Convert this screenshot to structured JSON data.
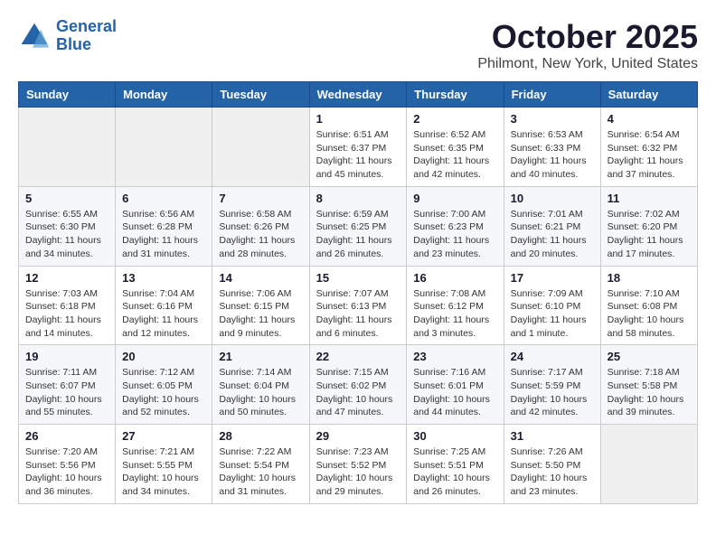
{
  "logo": {
    "line1": "General",
    "line2": "Blue"
  },
  "title": "October 2025",
  "location": "Philmont, New York, United States",
  "weekdays": [
    "Sunday",
    "Monday",
    "Tuesday",
    "Wednesday",
    "Thursday",
    "Friday",
    "Saturday"
  ],
  "weeks": [
    [
      {
        "day": "",
        "info": ""
      },
      {
        "day": "",
        "info": ""
      },
      {
        "day": "",
        "info": ""
      },
      {
        "day": "1",
        "info": "Sunrise: 6:51 AM\nSunset: 6:37 PM\nDaylight: 11 hours and 45 minutes."
      },
      {
        "day": "2",
        "info": "Sunrise: 6:52 AM\nSunset: 6:35 PM\nDaylight: 11 hours and 42 minutes."
      },
      {
        "day": "3",
        "info": "Sunrise: 6:53 AM\nSunset: 6:33 PM\nDaylight: 11 hours and 40 minutes."
      },
      {
        "day": "4",
        "info": "Sunrise: 6:54 AM\nSunset: 6:32 PM\nDaylight: 11 hours and 37 minutes."
      }
    ],
    [
      {
        "day": "5",
        "info": "Sunrise: 6:55 AM\nSunset: 6:30 PM\nDaylight: 11 hours and 34 minutes."
      },
      {
        "day": "6",
        "info": "Sunrise: 6:56 AM\nSunset: 6:28 PM\nDaylight: 11 hours and 31 minutes."
      },
      {
        "day": "7",
        "info": "Sunrise: 6:58 AM\nSunset: 6:26 PM\nDaylight: 11 hours and 28 minutes."
      },
      {
        "day": "8",
        "info": "Sunrise: 6:59 AM\nSunset: 6:25 PM\nDaylight: 11 hours and 26 minutes."
      },
      {
        "day": "9",
        "info": "Sunrise: 7:00 AM\nSunset: 6:23 PM\nDaylight: 11 hours and 23 minutes."
      },
      {
        "day": "10",
        "info": "Sunrise: 7:01 AM\nSunset: 6:21 PM\nDaylight: 11 hours and 20 minutes."
      },
      {
        "day": "11",
        "info": "Sunrise: 7:02 AM\nSunset: 6:20 PM\nDaylight: 11 hours and 17 minutes."
      }
    ],
    [
      {
        "day": "12",
        "info": "Sunrise: 7:03 AM\nSunset: 6:18 PM\nDaylight: 11 hours and 14 minutes."
      },
      {
        "day": "13",
        "info": "Sunrise: 7:04 AM\nSunset: 6:16 PM\nDaylight: 11 hours and 12 minutes."
      },
      {
        "day": "14",
        "info": "Sunrise: 7:06 AM\nSunset: 6:15 PM\nDaylight: 11 hours and 9 minutes."
      },
      {
        "day": "15",
        "info": "Sunrise: 7:07 AM\nSunset: 6:13 PM\nDaylight: 11 hours and 6 minutes."
      },
      {
        "day": "16",
        "info": "Sunrise: 7:08 AM\nSunset: 6:12 PM\nDaylight: 11 hours and 3 minutes."
      },
      {
        "day": "17",
        "info": "Sunrise: 7:09 AM\nSunset: 6:10 PM\nDaylight: 11 hours and 1 minute."
      },
      {
        "day": "18",
        "info": "Sunrise: 7:10 AM\nSunset: 6:08 PM\nDaylight: 10 hours and 58 minutes."
      }
    ],
    [
      {
        "day": "19",
        "info": "Sunrise: 7:11 AM\nSunset: 6:07 PM\nDaylight: 10 hours and 55 minutes."
      },
      {
        "day": "20",
        "info": "Sunrise: 7:12 AM\nSunset: 6:05 PM\nDaylight: 10 hours and 52 minutes."
      },
      {
        "day": "21",
        "info": "Sunrise: 7:14 AM\nSunset: 6:04 PM\nDaylight: 10 hours and 50 minutes."
      },
      {
        "day": "22",
        "info": "Sunrise: 7:15 AM\nSunset: 6:02 PM\nDaylight: 10 hours and 47 minutes."
      },
      {
        "day": "23",
        "info": "Sunrise: 7:16 AM\nSunset: 6:01 PM\nDaylight: 10 hours and 44 minutes."
      },
      {
        "day": "24",
        "info": "Sunrise: 7:17 AM\nSunset: 5:59 PM\nDaylight: 10 hours and 42 minutes."
      },
      {
        "day": "25",
        "info": "Sunrise: 7:18 AM\nSunset: 5:58 PM\nDaylight: 10 hours and 39 minutes."
      }
    ],
    [
      {
        "day": "26",
        "info": "Sunrise: 7:20 AM\nSunset: 5:56 PM\nDaylight: 10 hours and 36 minutes."
      },
      {
        "day": "27",
        "info": "Sunrise: 7:21 AM\nSunset: 5:55 PM\nDaylight: 10 hours and 34 minutes."
      },
      {
        "day": "28",
        "info": "Sunrise: 7:22 AM\nSunset: 5:54 PM\nDaylight: 10 hours and 31 minutes."
      },
      {
        "day": "29",
        "info": "Sunrise: 7:23 AM\nSunset: 5:52 PM\nDaylight: 10 hours and 29 minutes."
      },
      {
        "day": "30",
        "info": "Sunrise: 7:25 AM\nSunset: 5:51 PM\nDaylight: 10 hours and 26 minutes."
      },
      {
        "day": "31",
        "info": "Sunrise: 7:26 AM\nSunset: 5:50 PM\nDaylight: 10 hours and 23 minutes."
      },
      {
        "day": "",
        "info": ""
      }
    ]
  ]
}
